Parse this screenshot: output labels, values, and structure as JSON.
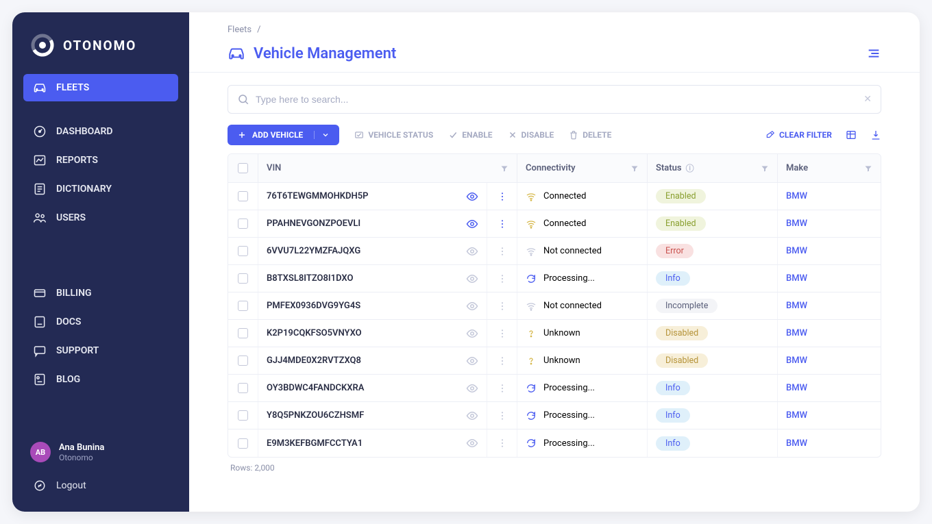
{
  "logo_text": "OTONOMO",
  "sidebar": {
    "groups": [
      {
        "items": [
          {
            "label": "FLEETS",
            "active": true,
            "icon": "car"
          }
        ]
      },
      {
        "items": [
          {
            "label": "DASHBOARD",
            "icon": "gauge"
          },
          {
            "label": "REPORTS",
            "icon": "chart"
          },
          {
            "label": "DICTIONARY",
            "icon": "book-lines"
          },
          {
            "label": "USERS",
            "icon": "people"
          }
        ]
      },
      {
        "items": [
          {
            "label": "BILLING",
            "icon": "card"
          },
          {
            "label": "DOCS",
            "icon": "doc"
          },
          {
            "label": "SUPPORT",
            "icon": "chat"
          },
          {
            "label": "BLOG",
            "icon": "blog"
          }
        ]
      }
    ]
  },
  "user": {
    "initials": "AB",
    "name": "Ana Bunina",
    "org": "Otonomo"
  },
  "logout_label": "Logout",
  "breadcrumb": {
    "items": [
      "Fleets"
    ],
    "sep": "/"
  },
  "page_title": "Vehicle Management",
  "search": {
    "placeholder": "Type here to search..."
  },
  "toolbar": {
    "add_vehicle": "ADD VEHICLE",
    "vehicle_status": "VEHICLE STATUS",
    "enable": "ENABLE",
    "disable": "DISABLE",
    "delete": "DELETE",
    "clear_filter": "CLEAR FILTER"
  },
  "columns": {
    "vin": "VIN",
    "connectivity": "Connectivity",
    "status": "Status",
    "make": "Make"
  },
  "rows": [
    {
      "vin": "76T6TEWGMMOHKDH5P",
      "eye_active": true,
      "connectivity": "Connected",
      "conn_kind": "wifi-good",
      "status": "Enabled",
      "status_kind": "enabled",
      "make": "BMW"
    },
    {
      "vin": "PPAHNEVGONZPOEVLI",
      "eye_active": true,
      "connectivity": "Connected",
      "conn_kind": "wifi-good",
      "status": "Enabled",
      "status_kind": "enabled",
      "make": "BMW"
    },
    {
      "vin": "6VVU7L22YMZFAJQXG",
      "eye_active": false,
      "connectivity": "Not connected",
      "conn_kind": "wifi-off",
      "status": "Error",
      "status_kind": "error",
      "make": "BMW"
    },
    {
      "vin": "B8TXSL8ITZO8I1DXO",
      "eye_active": false,
      "connectivity": "Processing...",
      "conn_kind": "processing",
      "status": "Info",
      "status_kind": "info",
      "make": "BMW"
    },
    {
      "vin": "PMFEX0936DVG9YG4S",
      "eye_active": false,
      "connectivity": "Not connected",
      "conn_kind": "wifi-off",
      "status": "Incomplete",
      "status_kind": "incomplete",
      "make": "BMW"
    },
    {
      "vin": "K2P19CQKFSO5VNYXO",
      "eye_active": false,
      "connectivity": "Unknown",
      "conn_kind": "unknown",
      "status": "Disabled",
      "status_kind": "disabled",
      "make": "BMW"
    },
    {
      "vin": "GJJ4MDE0X2RVTZXQ8",
      "eye_active": false,
      "connectivity": "Unknown",
      "conn_kind": "unknown",
      "status": "Disabled",
      "status_kind": "disabled",
      "make": "BMW"
    },
    {
      "vin": "OY3BDWC4FANDCKXRA",
      "eye_active": false,
      "connectivity": "Processing...",
      "conn_kind": "processing",
      "status": "Info",
      "status_kind": "info",
      "make": "BMW"
    },
    {
      "vin": "Y8Q5PNKZOU6CZHSMF",
      "eye_active": false,
      "connectivity": "Processing...",
      "conn_kind": "processing",
      "status": "Info",
      "status_kind": "info",
      "make": "BMW"
    },
    {
      "vin": "E9M3KEFBGMFCCTYA1",
      "eye_active": false,
      "connectivity": "Processing...",
      "conn_kind": "processing",
      "status": "Info",
      "status_kind": "info",
      "make": "BMW"
    }
  ],
  "rows_label": "Rows: 2,000"
}
